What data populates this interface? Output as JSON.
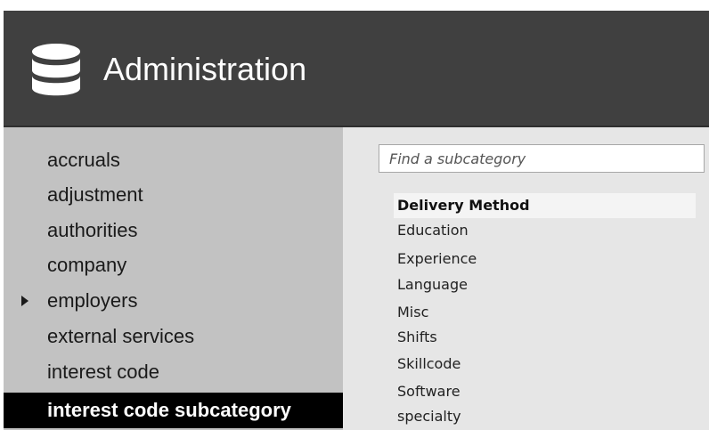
{
  "header": {
    "title": "Administration",
    "icon": "database-icon",
    "background": "#404040"
  },
  "sidebar": {
    "items": [
      {
        "label": "accruals",
        "expandable": false,
        "active": false
      },
      {
        "label": "adjustment",
        "expandable": false,
        "active": false
      },
      {
        "label": "authorities",
        "expandable": false,
        "active": false
      },
      {
        "label": "company",
        "expandable": false,
        "active": false
      },
      {
        "label": "employers",
        "expandable": true,
        "active": false
      },
      {
        "label": "external services",
        "expandable": false,
        "active": false
      },
      {
        "label": "interest code",
        "expandable": false,
        "active": false
      },
      {
        "label": "interest code subcategory",
        "expandable": false,
        "active": true
      }
    ]
  },
  "search": {
    "placeholder": "Find a subcategory",
    "value": ""
  },
  "subcategories": {
    "items": [
      {
        "label": "Delivery Method",
        "highlighted": true
      },
      {
        "label": "Education",
        "highlighted": false
      },
      {
        "label": "Experience",
        "highlighted": false
      },
      {
        "label": "Language",
        "highlighted": false
      },
      {
        "label": "Misc",
        "highlighted": false
      },
      {
        "label": "Shifts",
        "highlighted": false
      },
      {
        "label": "Skillcode",
        "highlighted": false
      },
      {
        "label": "Software",
        "highlighted": false
      },
      {
        "label": "specialty",
        "highlighted": false
      }
    ]
  },
  "colors": {
    "sidebar_bg": "#c2c2c2",
    "active_bg": "#000000",
    "main_bg": "#e6e6e6"
  }
}
